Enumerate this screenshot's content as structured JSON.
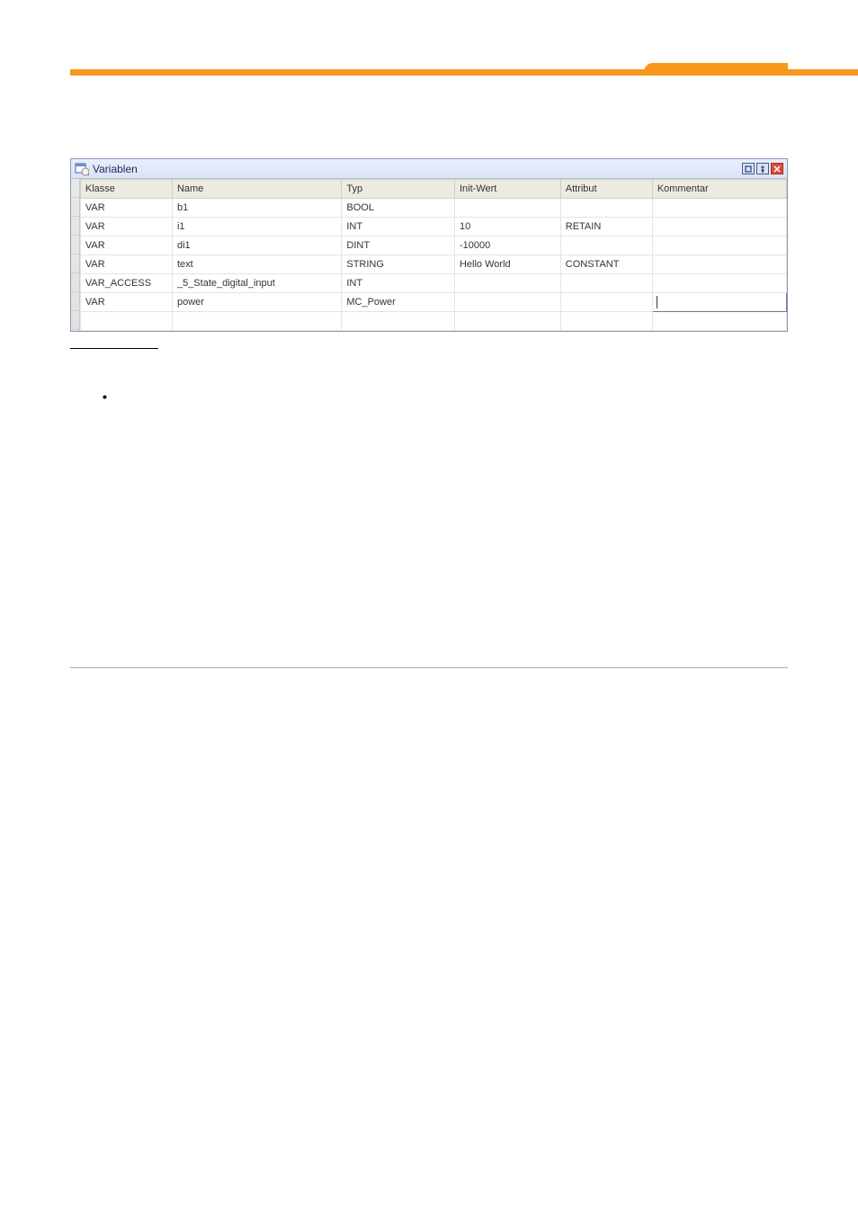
{
  "window": {
    "title": "Variablen"
  },
  "table": {
    "headers": {
      "klasse": "Klasse",
      "name": "Name",
      "typ": "Typ",
      "init": "Init-Wert",
      "attr": "Attribut",
      "komm": "Kommentar"
    },
    "rows": [
      {
        "klasse": "VAR",
        "name": "b1",
        "typ": "BOOL",
        "init": "",
        "attr": "",
        "komm": ""
      },
      {
        "klasse": "VAR",
        "name": "i1",
        "typ": "INT",
        "init": "10",
        "attr": "RETAIN",
        "komm": ""
      },
      {
        "klasse": "VAR",
        "name": "di1",
        "typ": "DINT",
        "init": "-10000",
        "attr": "",
        "komm": ""
      },
      {
        "klasse": "VAR",
        "name": "text",
        "typ": "STRING",
        "init": "Hello World",
        "attr": "CONSTANT",
        "komm": ""
      },
      {
        "klasse": "VAR_ACCESS",
        "name": "_5_State_digital_input",
        "typ": "INT",
        "init": "",
        "attr": "",
        "komm": ""
      },
      {
        "klasse": "VAR",
        "name": "power",
        "typ": "MC_Power",
        "init": "",
        "attr": "",
        "komm": ""
      }
    ]
  },
  "bullets": [
    "",
    "",
    "",
    ""
  ]
}
